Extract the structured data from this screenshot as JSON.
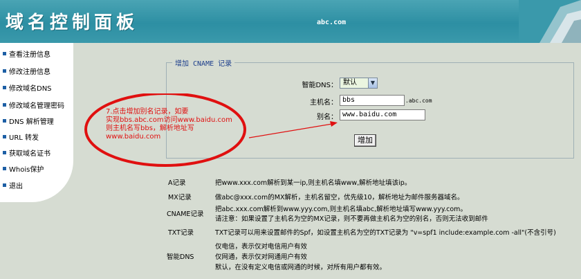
{
  "header": {
    "title": "域名控制面板",
    "domain": "abc.com"
  },
  "sidebar": {
    "items": [
      {
        "label": "查看注册信息"
      },
      {
        "label": "修改注册信息"
      },
      {
        "label": "修改域名DNS"
      },
      {
        "label": "修改域名管理密码"
      },
      {
        "label": "DNS 解析管理"
      },
      {
        "label": "URL 转发"
      },
      {
        "label": "获取域名证书"
      },
      {
        "label": "Whois保护"
      },
      {
        "label": "退出"
      }
    ]
  },
  "form": {
    "legend": "增加 CNAME 记录",
    "dns_label": "智能DNS：",
    "dns_value": "默认",
    "host_label": "主机名：",
    "host_value": "bbs",
    "host_suffix": ".abc.com",
    "alias_label": "别名：",
    "alias_value": "www.baidu.com",
    "add_button": "增加"
  },
  "annotation": {
    "lines": [
      "7.点击增加别名记录，如要",
      "实现bbs.abc.com访问www.baidu.com",
      "则主机名写bbs，解析地址写",
      "www.baidu.com"
    ]
  },
  "info": [
    {
      "label": "A记录",
      "lines": [
        "把www.xxx.com解析到某一ip,则主机名填www,解析地址填该ip。"
      ]
    },
    {
      "label": "MX记录",
      "lines": [
        "做abc@xxx.com的MX解析，主机名留空，优先级10，解析地址为邮件服务器域名。"
      ]
    },
    {
      "label": "CNAME记录",
      "lines": [
        "把abc.xxx.com解析到www.yyy.com,则主机名填abc,解析地址填写www.yyy.com。",
        "请注意：如果设置了主机名为空的MX记录，则不要再做主机名为空的别名，否则无法收到邮件"
      ]
    },
    {
      "label": "TXT记录",
      "lines": [
        "TXT记录可以用来设置邮件的Spf，如设置主机名为空的TXT记录为 \"v=spf1 include:example.com -all\"(不含引号)"
      ]
    },
    {
      "label": "智能DNS",
      "lines": [
        "仅电信，表示仅对电信用户有效",
        "仅网通，表示仅对网通用户有效",
        "默认，在没有定义电信或网通的时候，对所有用户都有效。"
      ]
    }
  ],
  "colors": {
    "header": "#3a99ab",
    "background": "#d6dcd2",
    "annotation": "#e01010",
    "legend_text": "#1c3e8c"
  }
}
